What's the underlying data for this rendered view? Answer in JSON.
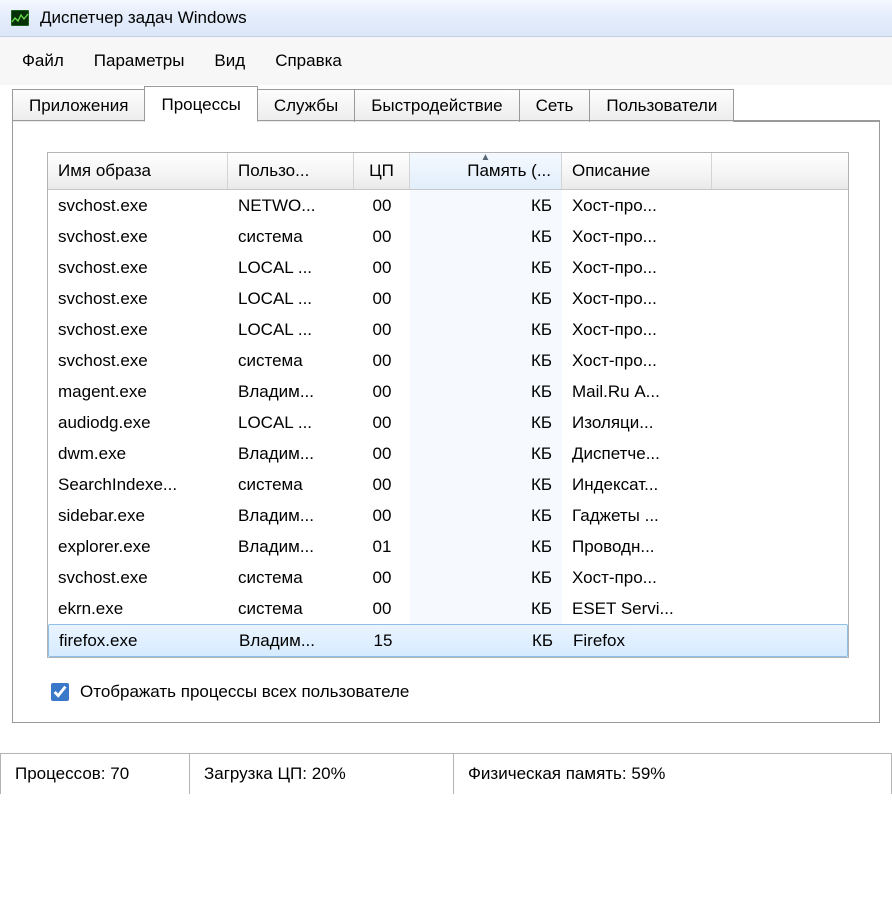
{
  "window": {
    "title": "Диспетчер задач Windows"
  },
  "menu": {
    "file": "Файл",
    "options": "Параметры",
    "view": "Вид",
    "help": "Справка"
  },
  "tabs": {
    "applications": "Приложения",
    "processes": "Процессы",
    "services": "Службы",
    "performance": "Быстродействие",
    "network": "Сеть",
    "users": "Пользователи"
  },
  "columns": {
    "name": "Имя образа",
    "user": "Пользо...",
    "cpu": "ЦП",
    "memory": "Память (...",
    "description": "Описание"
  },
  "rows": [
    {
      "name": "svchost.exe",
      "user": "NETWO...",
      "cpu": "00",
      "mem": "КБ",
      "desc": "Хост-про..."
    },
    {
      "name": "svchost.exe",
      "user": "система",
      "cpu": "00",
      "mem": "КБ",
      "desc": "Хост-про..."
    },
    {
      "name": "svchost.exe",
      "user": "LOCAL ...",
      "cpu": "00",
      "mem": "КБ",
      "desc": "Хост-про..."
    },
    {
      "name": "svchost.exe",
      "user": "LOCAL ...",
      "cpu": "00",
      "mem": "КБ",
      "desc": "Хост-про..."
    },
    {
      "name": "svchost.exe",
      "user": "LOCAL ...",
      "cpu": "00",
      "mem": "КБ",
      "desc": "Хост-про..."
    },
    {
      "name": "svchost.exe",
      "user": "система",
      "cpu": "00",
      "mem": "КБ",
      "desc": "Хост-про..."
    },
    {
      "name": "magent.exe",
      "user": "Владим...",
      "cpu": "00",
      "mem": "КБ",
      "desc": "Mail.Ru А..."
    },
    {
      "name": "audiodg.exe",
      "user": "LOCAL ...",
      "cpu": "00",
      "mem": "КБ",
      "desc": "Изоляци..."
    },
    {
      "name": "dwm.exe",
      "user": "Владим...",
      "cpu": "00",
      "mem": "КБ",
      "desc": "Диспетче..."
    },
    {
      "name": "SearchIndexe...",
      "user": "система",
      "cpu": "00",
      "mem": "КБ",
      "desc": "Индексат..."
    },
    {
      "name": "sidebar.exe",
      "user": "Владим...",
      "cpu": "00",
      "mem": "КБ",
      "desc": "Гаджеты ..."
    },
    {
      "name": "explorer.exe",
      "user": "Владим...",
      "cpu": "01",
      "mem": "КБ",
      "desc": "Проводн..."
    },
    {
      "name": "svchost.exe",
      "user": "система",
      "cpu": "00",
      "mem": "КБ",
      "desc": "Хост-про..."
    },
    {
      "name": "ekrn.exe",
      "user": "система",
      "cpu": "00",
      "mem": "КБ",
      "desc": "ESET Servi..."
    },
    {
      "name": "firefox.exe",
      "user": "Владим...",
      "cpu": "15",
      "mem": "КБ",
      "desc": "Firefox",
      "selected": true
    }
  ],
  "checkbox": {
    "label": "Отображать процессы всех пользователе",
    "checked": true
  },
  "status": {
    "processes": "Процессов: 70",
    "cpu": "Загрузка ЦП: 20%",
    "memory": "Физическая память: 59%"
  }
}
